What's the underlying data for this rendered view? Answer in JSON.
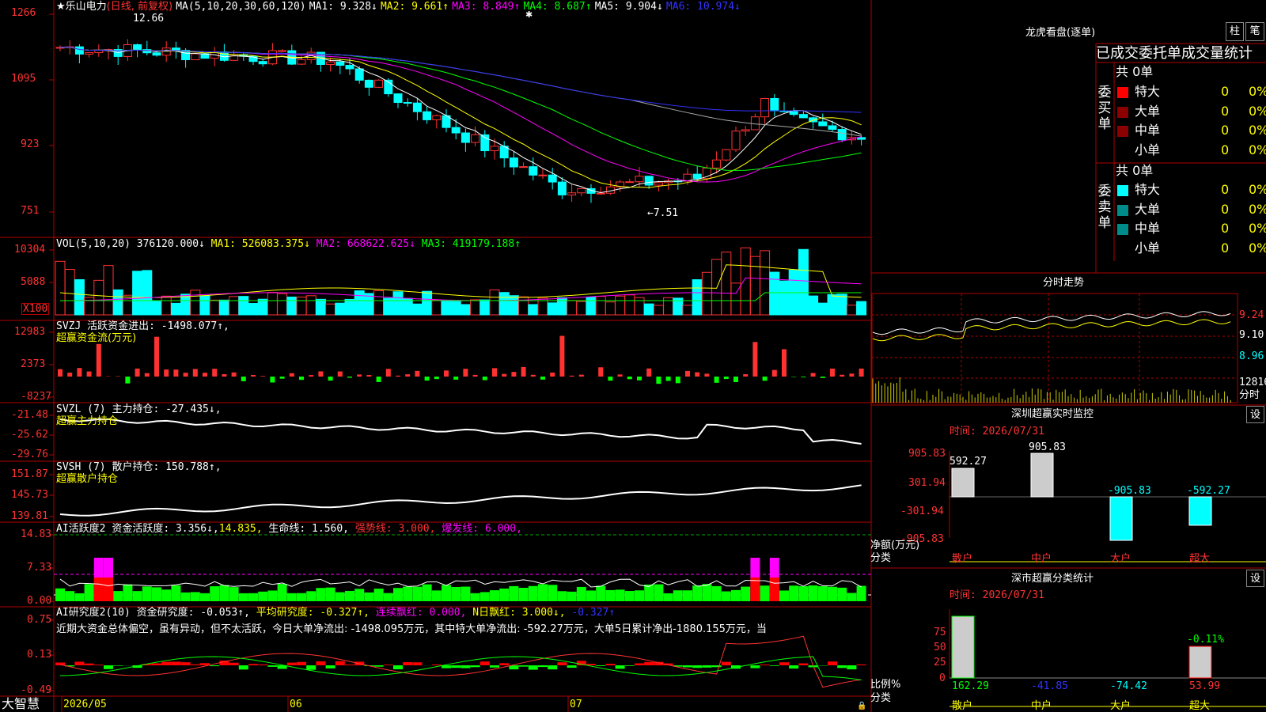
{
  "stock": {
    "star": "★",
    "name": "乐山电力",
    "period": "(日线, 前复权)"
  },
  "k_panel": {
    "ma_params": "MA(5,10,20,30,60,120)",
    "ma1": "MA1: 9.328↓",
    "ma2": "MA2: 9.661↑",
    "ma3": "MA3: 8.849↑",
    "ma4": "MA4: 8.687↑",
    "ma5": "MA5: 9.904↓",
    "ma6": "MA6: 10.974↓",
    "yticks": [
      "1266",
      "1095",
      "923",
      "751"
    ],
    "high_mark": "12.66",
    "low_mark": "←7.51",
    "cross": "✱"
  },
  "vol_panel": {
    "params": "VOL(5,10,20)",
    "vol": "376120.000↓",
    "ma1": "MA1: 526083.375↓",
    "ma2": "MA2: 668622.625↓",
    "ma3": "MA3: 419179.188↑",
    "yticks": [
      "10304",
      "5088"
    ],
    "unit": "X100"
  },
  "svzj_panel": {
    "line1": "SVZJ  活跃资金进出: -1498.077↑,",
    "line2": "超赢资金流(万元)",
    "yticks": [
      "12983",
      "2373",
      "-8237"
    ]
  },
  "svzl_panel": {
    "line1": "SVZL (7) 主力持仓: -27.435↓,",
    "line2": "超赢主力持仓",
    "yticks": [
      "-21.48",
      "-25.62",
      "-29.76"
    ]
  },
  "svsh_panel": {
    "line1": "SVSH (7) 散户持仓: 150.788↑,",
    "line2": "超赢散户持仓",
    "yticks": [
      "151.87",
      "145.73",
      "139.81"
    ]
  },
  "ai1_panel": {
    "name": "AI活跃度2",
    "active": "资金活跃度: 3.356↓,",
    "v2": "14.835,",
    "life": "生命线: 1.560,",
    "strong": "强势线: 3.000,",
    "burst": "爆发线: 6.000,",
    "yticks": [
      "14.83",
      "7.33",
      "0.00"
    ]
  },
  "ai2_panel": {
    "name": "AI研究度2(10)",
    "research": "资金研究度: -0.053↑,",
    "avg": "平均研究度: -0.327↑,",
    "red": "连续飘红: 0.000,",
    "nday": "N日飘红: 3.000↓,",
    "nv": "-0.327↑",
    "comment": "近期大资金总体偏空，虽有异动，但不太活跃，今日大单净流出: -1498.095万元，其中特大单净流出: -592.27万元，大单5日累计净出-1880.155万元，当",
    "yticks": [
      "0.75",
      "0.13",
      "-0.49"
    ]
  },
  "xaxis": {
    "brand": "大智慧",
    "labels": [
      "2026/05",
      "06",
      "07"
    ]
  },
  "lhb": {
    "title": "龙虎看盘(逐单)",
    "btn1": "柱",
    "btn2": "笔",
    "subtitle": "已成交委托单成交量统计",
    "buy": {
      "side": "委买单",
      "total": "共 0单",
      "rows": [
        {
          "name": "特大",
          "v": "0",
          "p": "0%"
        },
        {
          "name": "大单",
          "v": "0",
          "p": "0%"
        },
        {
          "name": "中单",
          "v": "0",
          "p": "0%"
        },
        {
          "name": "小单",
          "v": "0",
          "p": "0%"
        }
      ]
    },
    "sell": {
      "side": "委卖单",
      "total": "共 0单",
      "rows": [
        {
          "name": "特大",
          "v": "0",
          "p": "0%"
        },
        {
          "name": "大单",
          "v": "0",
          "p": "0%"
        },
        {
          "name": "中单",
          "v": "0",
          "p": "0%"
        },
        {
          "name": "小单",
          "v": "0",
          "p": "0%"
        }
      ]
    }
  },
  "intraday": {
    "title": "分时走势",
    "prices": [
      "9.24",
      "9.10",
      "8.96"
    ],
    "vol": "12816",
    "unit": "分时"
  },
  "sz_monitor": {
    "title": "深圳超赢实时监控",
    "btn": "设",
    "time": "时间: 2026/07/31",
    "yticks": [
      "905.83",
      "301.94",
      "-301.94",
      "-905.83"
    ],
    "ylabel": "净额(万元)",
    "xlabel": "分类",
    "bars": [
      {
        "cat": "散户",
        "value": 592.27,
        "label": "592.27"
      },
      {
        "cat": "中户",
        "value": 905.83,
        "label": "905.83"
      },
      {
        "cat": "大户",
        "value": -905.83,
        "label": "-905.83"
      },
      {
        "cat": "超大",
        "value": -592.27,
        "label": "-592.27"
      }
    ]
  },
  "sz_class": {
    "title": "深市超赢分类统计",
    "btn": "设",
    "time": "时间: 2026/07/31",
    "yticks": [
      "75",
      "50",
      "25",
      "0"
    ],
    "ylabel": "比例%",
    "xlabel": "分类",
    "top_label": "-0.11%",
    "bars": [
      {
        "cat": "散户",
        "label": "162.29"
      },
      {
        "cat": "中户",
        "label": "-41.85"
      },
      {
        "cat": "大户",
        "label": "-74.42"
      },
      {
        "cat": "超大",
        "label": "53.99"
      }
    ]
  },
  "colors": {
    "up": "#ff3232",
    "down": "#00ffff",
    "ma1": "#ffffff",
    "ma2": "#ffff00",
    "ma3": "#ff00ff",
    "ma4": "#00ff00",
    "ma5": "#aaaaaa",
    "ma6": "#3333ff",
    "axis": "#b00000"
  }
}
